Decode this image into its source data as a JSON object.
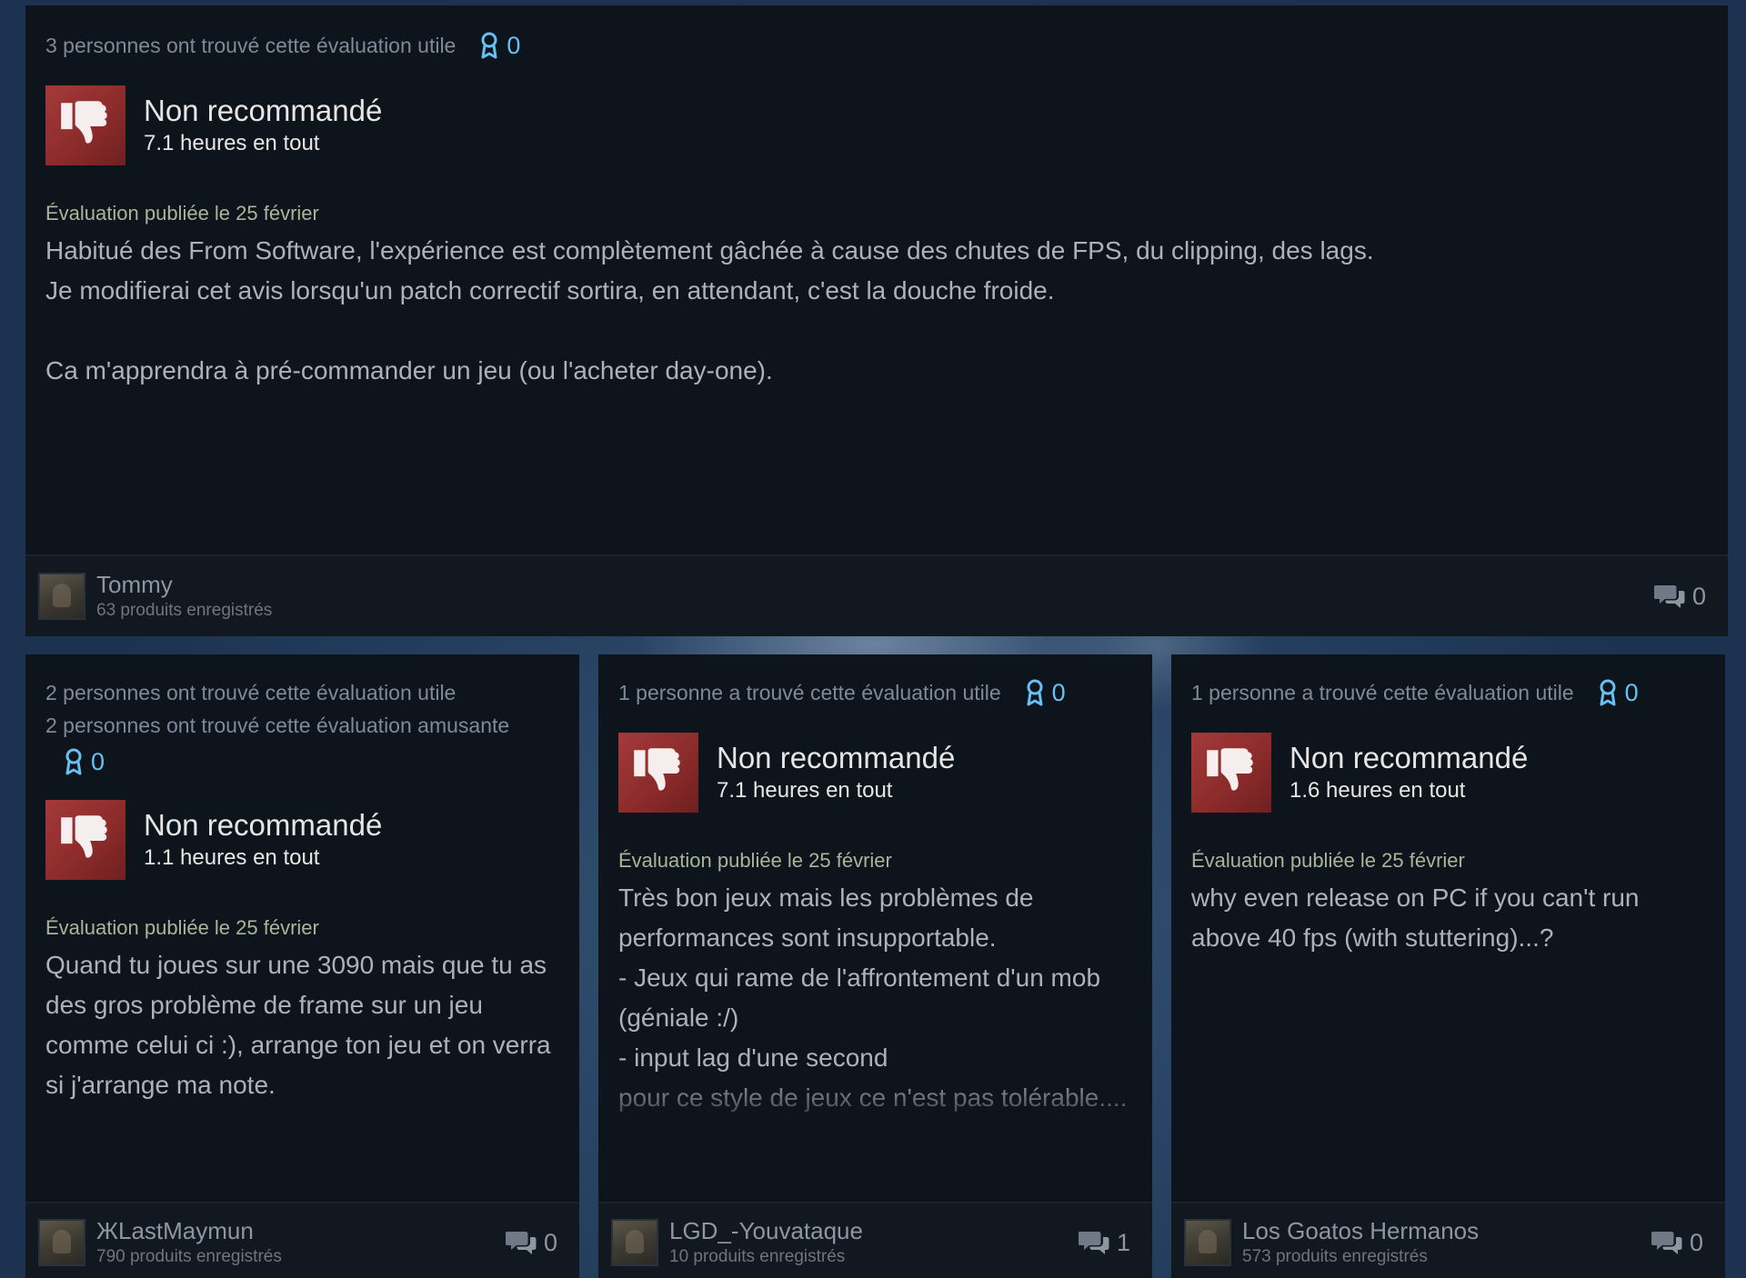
{
  "colors": {
    "card_bg": "#0e141b",
    "accent_blue": "#66c0f4",
    "thumb_red": "#a43a3a",
    "posted_green": "#a9b59a"
  },
  "reviews": [
    {
      "helpful_lines": [
        "3 personnes ont trouvé cette évaluation utile"
      ],
      "awards": "0",
      "recommendation": "Non recommandé",
      "hours": "7.1 heures en tout",
      "posted": "Évaluation publiée le 25 février",
      "text": "Habitué des From Software, l'expérience est complètement gâchée à cause des chutes de FPS, du clipping, des lags.\nJe modifierai cet avis lorsqu'un patch correctif sortira, en attendant, c'est la douche froide.\n\nCa m'apprendra à pré-commander un jeu (ou l'acheter day-one).",
      "author": "Tommy",
      "products": "63 produits enregistrés",
      "comments": "0",
      "icons": {
        "recommendation": "thumbs-down-icon",
        "award": "award-ribbon-icon",
        "comments": "comment-bubbles-icon"
      }
    },
    {
      "helpful_lines": [
        "2 personnes ont trouvé cette évaluation utile",
        "2 personnes ont trouvé cette évaluation amusante"
      ],
      "awards": "0",
      "recommendation": "Non recommandé",
      "hours": "1.1 heures en tout",
      "posted": "Évaluation publiée le 25 février",
      "text": "Quand tu joues sur une 3090 mais que tu as des gros problème de frame sur un jeu comme celui ci :), arrange ton jeu et on verra si j'arrange ma note.",
      "author": "ЖLastMaymun",
      "products": "790 produits enregistrés",
      "comments": "0"
    },
    {
      "helpful_lines": [
        "1 personne a trouvé cette évaluation utile"
      ],
      "awards": "0",
      "recommendation": "Non recommandé",
      "hours": "7.1 heures en tout",
      "posted": "Évaluation publiée le 25 février",
      "text": "Très bon jeux mais les problèmes de performances sont insupportable.\n- Jeux qui rame de l'affrontement d'un mob (géniale :/)\n- input lag d'une second\npour ce style de jeux ce n'est pas tolérable....",
      "author": "LGD_-Youvataque",
      "products": "10 produits enregistrés",
      "comments": "1"
    },
    {
      "helpful_lines": [
        "1 personne a trouvé cette évaluation utile"
      ],
      "awards": "0",
      "recommendation": "Non recommandé",
      "hours": "1.6 heures en tout",
      "posted": "Évaluation publiée le 25 février",
      "text": "why even release on PC if you can't run above 40 fps (with stuttering)...?",
      "author": "Los Goatos Hermanos",
      "products": "573 produits enregistrés",
      "comments": "0"
    }
  ]
}
